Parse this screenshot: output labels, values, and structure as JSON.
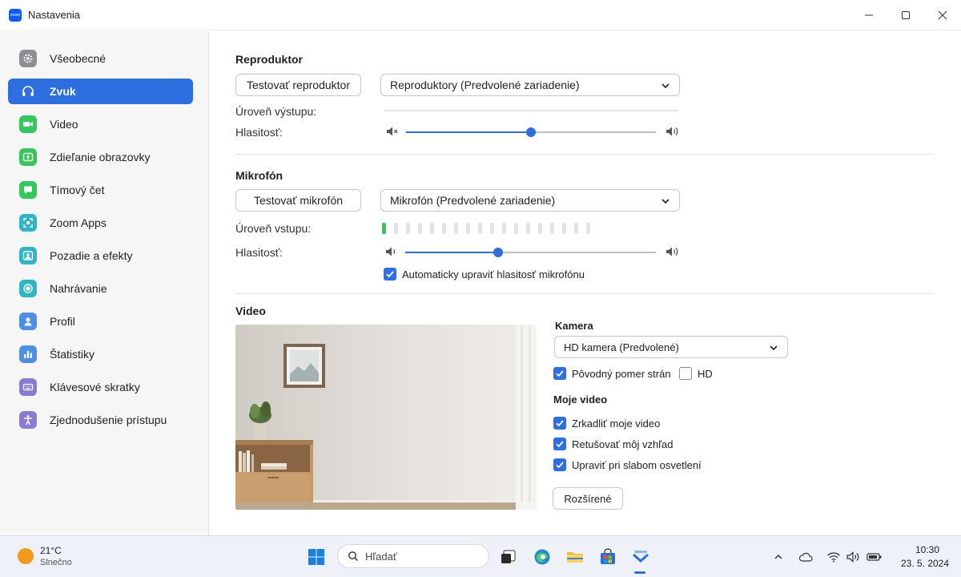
{
  "window": {
    "title": "Nastavenia",
    "app_icon_text": "zoom"
  },
  "sidebar": {
    "items": [
      {
        "label": "Všeobecné",
        "icon": "gear-icon",
        "color": "#8e8e93"
      },
      {
        "label": "Zvuk",
        "icon": "headphones-icon",
        "color": "#2d6ee0",
        "active": true
      },
      {
        "label": "Video",
        "icon": "video-camera-icon",
        "color": "#34c759"
      },
      {
        "label": "Zdieľanie obrazovky",
        "icon": "screen-share-icon",
        "color": "#34c759"
      },
      {
        "label": "Tímový čet",
        "icon": "chat-icon",
        "color": "#34c759"
      },
      {
        "label": "Zoom Apps",
        "icon": "apps-icon",
        "color": "#2fb6c6"
      },
      {
        "label": "Pozadie a efekty",
        "icon": "background-icon",
        "color": "#2fb6c6"
      },
      {
        "label": "Nahrávanie",
        "icon": "record-icon",
        "color": "#2fb6c6"
      },
      {
        "label": "Profil",
        "icon": "profile-icon",
        "color": "#4d8ee8"
      },
      {
        "label": "Štatistiky",
        "icon": "statistics-icon",
        "color": "#4d8ee8"
      },
      {
        "label": "Klávesové skratky",
        "icon": "keyboard-icon",
        "color": "#8a7ad6"
      },
      {
        "label": "Zjednodušenie prístupu",
        "icon": "accessibility-icon",
        "color": "#8a7ad6"
      }
    ]
  },
  "speaker": {
    "title": "Reproduktor",
    "test_button": "Testovať reproduktor",
    "device": "Reproduktory (Predvolené zariadenie)",
    "output_level_label": "Úroveň výstupu:",
    "volume_label": "Hlasitosť:",
    "volume": 0.5
  },
  "microphone": {
    "title": "Mikrofón",
    "test_button": "Testovať mikrofón",
    "device": "Mikrofón (Predvolené zariadenie)",
    "input_level_label": "Úroveň vstupu:",
    "input_level_bars_active": 1,
    "input_level_bars_total": 18,
    "volume_label": "Hlasitosť:",
    "volume": 0.37,
    "auto_adjust_label": "Automaticky upraviť hlasitosť mikrofónu",
    "auto_adjust": true
  },
  "video": {
    "title": "Video",
    "camera_label": "Kamera",
    "camera_device": "HD kamera (Predvolené)",
    "original_ratio_label": "Pôvodný pomer strán",
    "original_ratio": true,
    "hd_label": "HD",
    "hd": false,
    "my_video_label": "Moje video",
    "mirror_label": "Zrkadliť moje video",
    "mirror": true,
    "touch_up_label": "Retušovať môj vzhľad",
    "touch_up": true,
    "low_light_label": "Upraviť pri slabom osvetlení",
    "low_light": true,
    "advanced_button": "Rozšírené"
  },
  "taskbar": {
    "weather_temp": "21°C",
    "weather_desc": "Slnečno",
    "search_placeholder": "Hľadať",
    "time": "10:30",
    "date": "23. 5. 2024"
  },
  "colors": {
    "accent": "#2d6ee0",
    "level_active": "#34c759"
  }
}
